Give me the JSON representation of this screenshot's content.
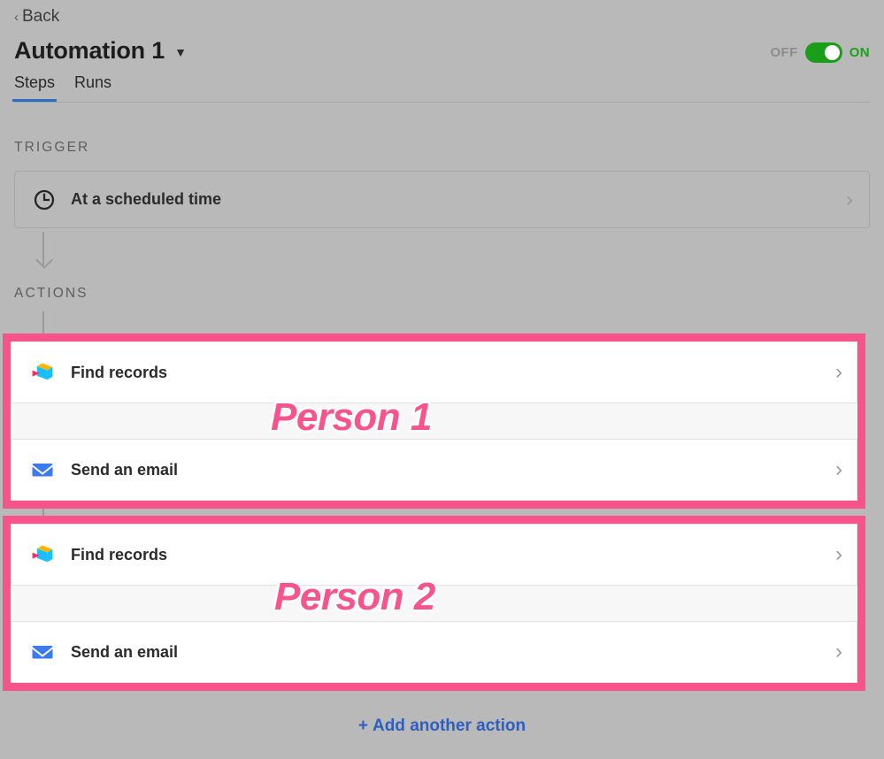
{
  "header": {
    "back_label": "Back",
    "back_icon": "chevron-left-icon",
    "title": "Automation 1",
    "title_caret_icon": "caret-down-icon",
    "toggle": {
      "off_label": "OFF",
      "on_label": "ON",
      "state": "on",
      "on_color": "#1a9e1a",
      "off_color": "#8d8d8d"
    }
  },
  "tabs": [
    {
      "label": "Steps",
      "active": true
    },
    {
      "label": "Runs",
      "active": false
    }
  ],
  "sections": {
    "trigger_label": "TRIGGER",
    "actions_label": "ACTIONS"
  },
  "trigger": {
    "icon": "clock-icon",
    "label": "At a scheduled time",
    "chevron_icon": "chevron-right-icon"
  },
  "groups": [
    {
      "annotation": "Person 1",
      "border_color": "#f8548c",
      "steps": [
        {
          "icon": "airtable-find-records-icon",
          "label": "Find records",
          "chevron_icon": "chevron-right-icon"
        },
        {
          "icon": "envelope-email-icon",
          "label": "Send an email",
          "chevron_icon": "chevron-right-icon"
        }
      ]
    },
    {
      "annotation": "Person 2",
      "border_color": "#f8548c",
      "steps": [
        {
          "icon": "airtable-find-records-icon",
          "label": "Find records",
          "chevron_icon": "chevron-right-icon"
        },
        {
          "icon": "envelope-email-icon",
          "label": "Send an email",
          "chevron_icon": "chevron-right-icon"
        }
      ]
    }
  ],
  "footer": {
    "add_action_plus": "+",
    "add_action_label": "Add another action",
    "link_color": "#2d5fbf"
  }
}
